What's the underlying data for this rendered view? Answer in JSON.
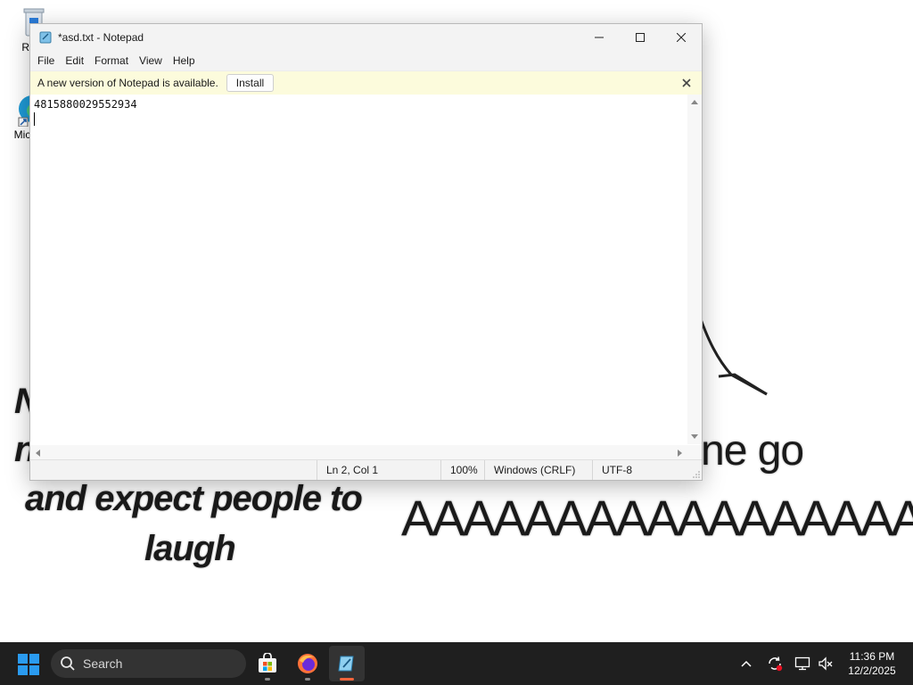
{
  "desktop": {
    "icons": [
      {
        "label": "Recy",
        "name": "recycle-bin"
      },
      {
        "label": "Micro E",
        "name": "microsoft-edge"
      }
    ],
    "wallpaper_text": {
      "left_line1": "N",
      "left_line2": "n",
      "left_line3": "and expect people to",
      "left_line4": "laugh",
      "right_line1": "ne go",
      "right_line2": "AAAAAAAAAAAAAAAAA"
    }
  },
  "window": {
    "title": "*asd.txt - Notepad",
    "controls": {
      "minimize": "minimize",
      "maximize": "maximize",
      "close": "close"
    },
    "menu": [
      "File",
      "Edit",
      "Format",
      "View",
      "Help"
    ],
    "infobar": {
      "message": "A new version of Notepad is available.",
      "install_label": "Install"
    },
    "editor": {
      "line1": "4815880029552934",
      "line2": ""
    },
    "status": {
      "position": "Ln 2, Col 1",
      "zoom": "100%",
      "line_ending": "Windows (CRLF)",
      "encoding": "UTF-8"
    }
  },
  "taskbar": {
    "search_placeholder": "Search",
    "apps": [
      "microsoft-store",
      "firefox",
      "notepad"
    ],
    "clock": {
      "time": "11:36 PM",
      "date": "12/2/2025"
    }
  },
  "colors": {
    "infobar_bg": "#fcfbdc",
    "taskbar_bg": "#1f1f1f",
    "accent_blue": "#0078d4"
  }
}
